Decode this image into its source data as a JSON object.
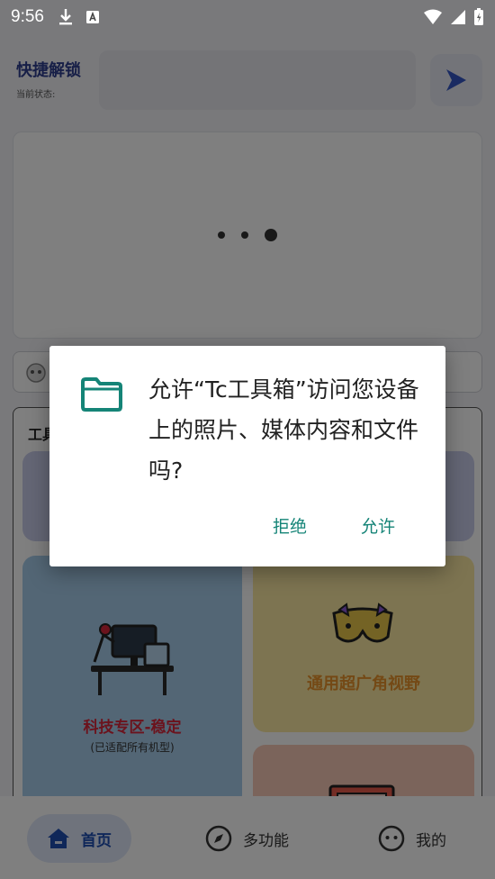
{
  "status_bar": {
    "time": "9:56",
    "left_icons": [
      "download-icon",
      "font-icon"
    ],
    "right_icons": [
      "wifi-icon",
      "signal-icon",
      "battery-icon"
    ]
  },
  "header": {
    "title": "快捷解锁",
    "state_label": "当前状态:"
  },
  "tools": {
    "title": "工具",
    "tiles": [
      {
        "label": "科技专区-稳定",
        "sub": "(已适配所有机型)"
      },
      {
        "label": "通用超广角视野"
      }
    ]
  },
  "bottom_nav": [
    {
      "label": "首页",
      "icon": "home-icon",
      "active": true
    },
    {
      "label": "多功能",
      "icon": "compass-icon",
      "active": false
    },
    {
      "label": "我的",
      "icon": "face-icon",
      "active": false
    }
  ],
  "dialog": {
    "icon": "folder-icon",
    "message": "允许“Tc工具箱”访问您设备上的照片、媒体内容和文件吗?",
    "deny_label": "拒绝",
    "allow_label": "允许"
  },
  "colors": {
    "accent": "#158477",
    "title": "#2f3e8f",
    "nav_active": "#1f4fb3",
    "tile_red_text": "#d6263b",
    "tile_orange_text": "#e8932a"
  }
}
